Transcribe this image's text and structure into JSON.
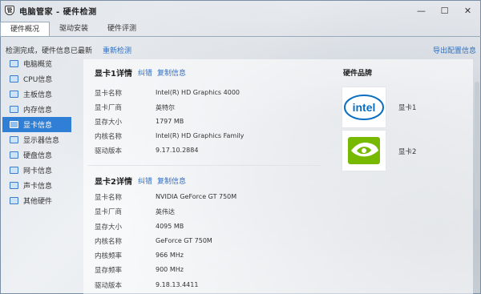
{
  "window": {
    "title": "电脑管家 - 硬件检测",
    "icon_text": "管"
  },
  "titlebar": {
    "minimize": "—",
    "maximize": "☐",
    "close": "✕"
  },
  "tabs": [
    {
      "label": "硬件概况",
      "active": true
    },
    {
      "label": "驱动安装",
      "active": false
    },
    {
      "label": "硬件评测",
      "active": false
    }
  ],
  "status": {
    "text": "检测完成，硬件信息已最新",
    "rescan": "重新检测",
    "export": "导出配置信息"
  },
  "sidebar": {
    "items": [
      {
        "label": "电脑概览",
        "icon": "computer-icon"
      },
      {
        "label": "CPU信息",
        "icon": "cpu-icon"
      },
      {
        "label": "主板信息",
        "icon": "motherboard-icon"
      },
      {
        "label": "内存信息",
        "icon": "memory-icon"
      },
      {
        "label": "显卡信息",
        "icon": "gpu-icon",
        "active": true
      },
      {
        "label": "显示器信息",
        "icon": "monitor-icon"
      },
      {
        "label": "硬盘信息",
        "icon": "disk-icon"
      },
      {
        "label": "网卡信息",
        "icon": "network-card-icon"
      },
      {
        "label": "声卡信息",
        "icon": "sound-card-icon"
      },
      {
        "label": "其他硬件",
        "icon": "other-hardware-icon"
      }
    ]
  },
  "card1": {
    "title": "显卡1详情",
    "correct": "纠错",
    "copy": "复制信息",
    "rows": [
      {
        "label": "显卡名称",
        "value": "Intel(R) HD Graphics 4000"
      },
      {
        "label": "显卡厂商",
        "value": "英特尔"
      },
      {
        "label": "显存大小",
        "value": "1797 MB"
      },
      {
        "label": "内核名称",
        "value": "Intel(R) HD Graphics Family"
      },
      {
        "label": "驱动版本",
        "value": "9.17.10.2884"
      }
    ]
  },
  "card2": {
    "title": "显卡2详情",
    "correct": "纠错",
    "copy": "复制信息",
    "rows": [
      {
        "label": "显卡名称",
        "value": "NVIDIA GeForce GT 750M"
      },
      {
        "label": "显卡厂商",
        "value": "英伟达"
      },
      {
        "label": "显存大小",
        "value": "4095 MB"
      },
      {
        "label": "内核名称",
        "value": "GeForce GT 750M"
      },
      {
        "label": "内核频率",
        "value": "966 MHz"
      },
      {
        "label": "显存频率",
        "value": "900 MHz"
      },
      {
        "label": "驱动版本",
        "value": "9.18.13.4411"
      }
    ]
  },
  "brands": {
    "title": "硬件品牌",
    "items": [
      {
        "logo": "intel-logo",
        "logo_text": "intel",
        "label": "显卡1"
      },
      {
        "logo": "nvidia-logo",
        "label": "显卡2"
      }
    ]
  }
}
